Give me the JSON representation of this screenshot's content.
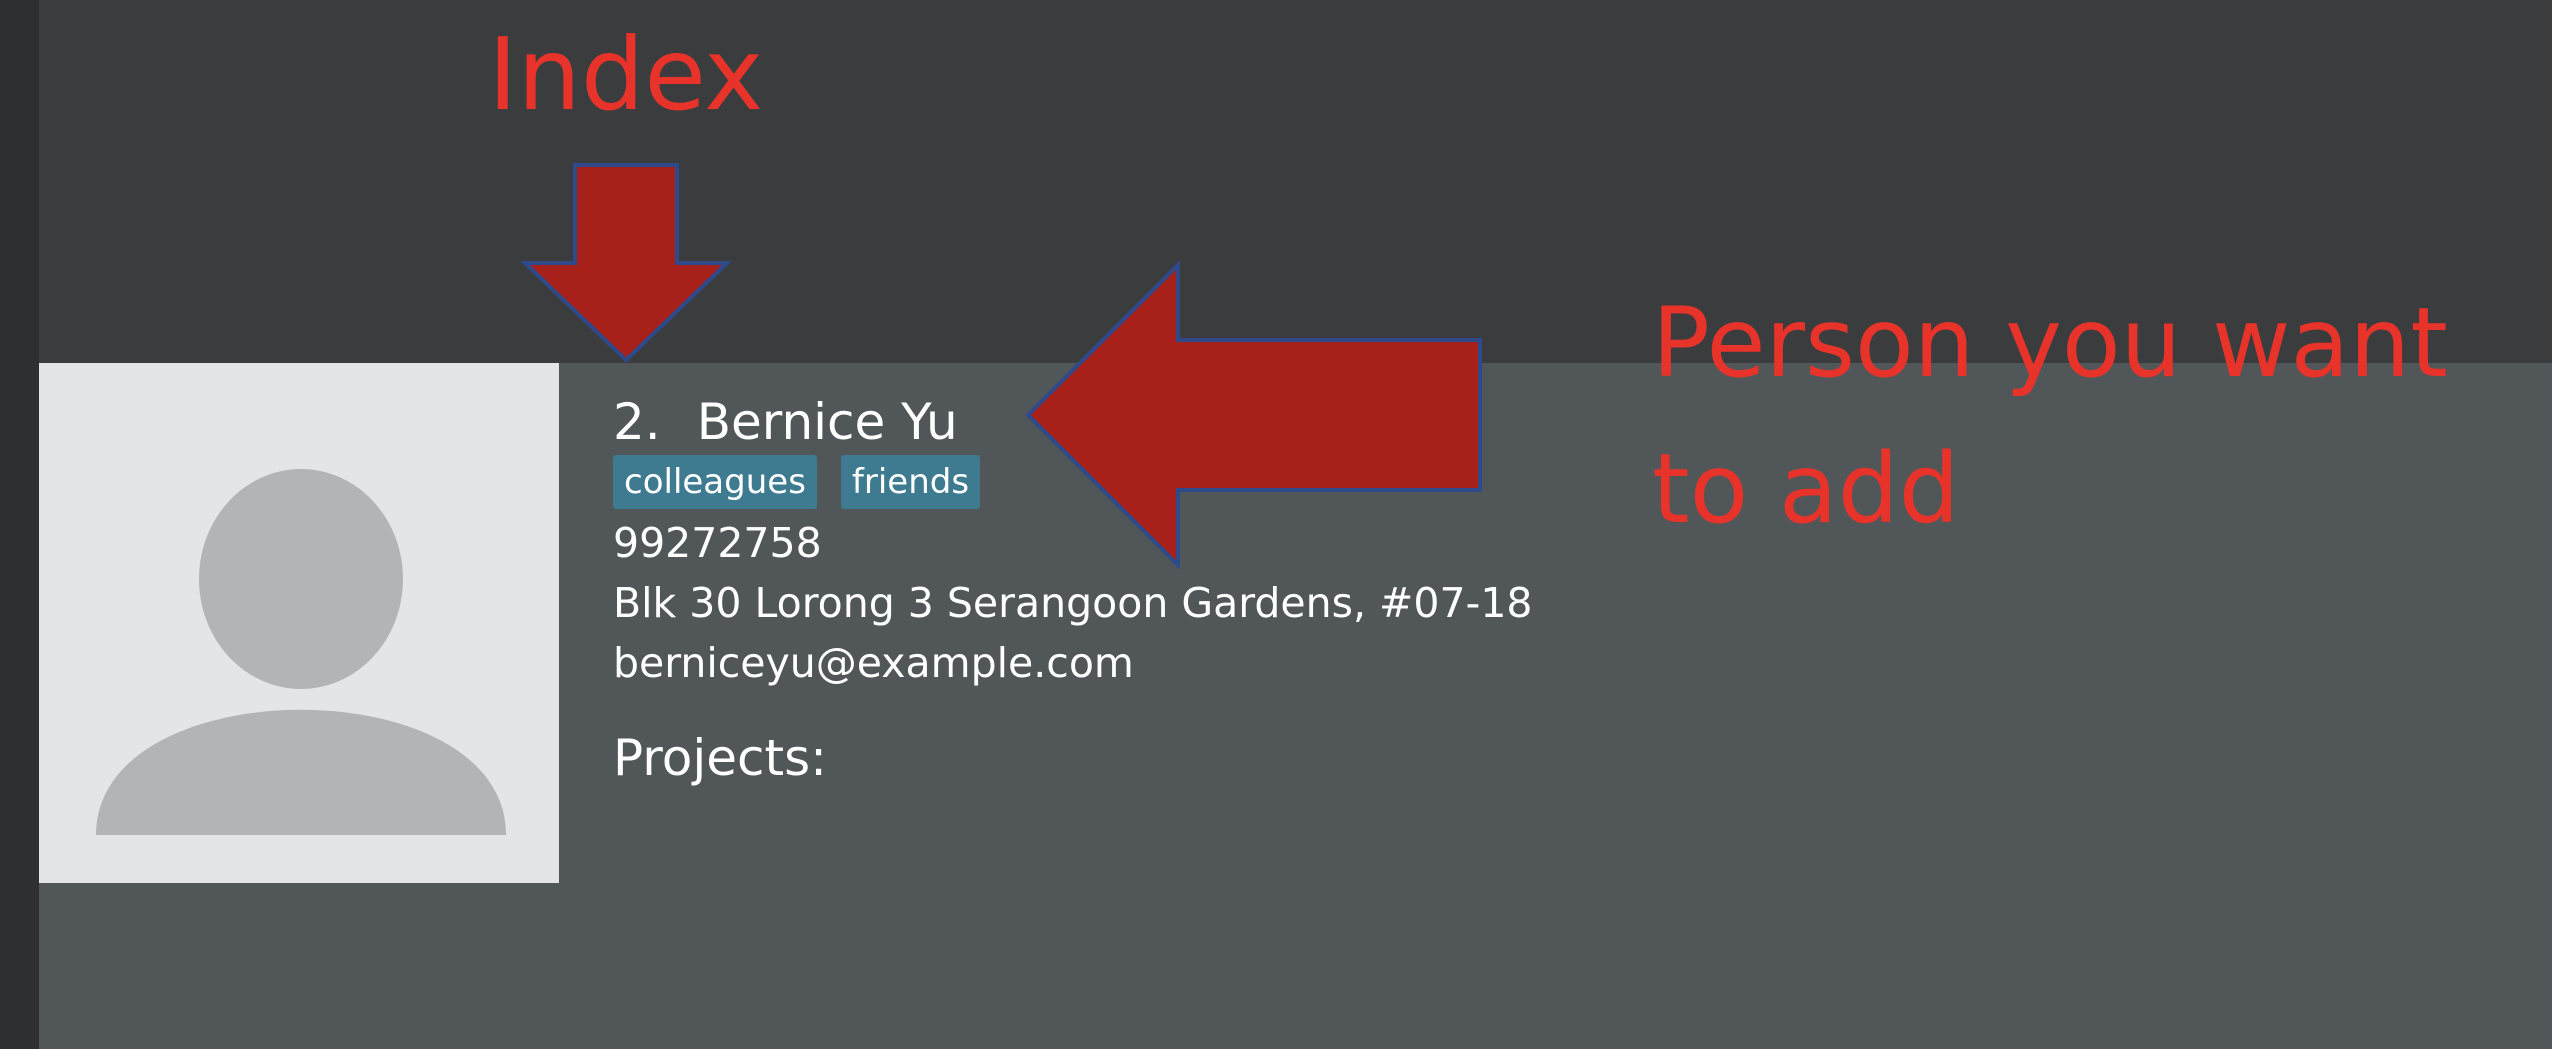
{
  "annotations": {
    "index_label": "Index",
    "person_label": "Person you want to add"
  },
  "person": {
    "index": "2.",
    "name": "Bernice Yu",
    "tags": [
      "colleagues",
      "friends"
    ],
    "phone": "99272758",
    "address": "Blk 30 Lorong 3 Serangoon Gardens, #07-18",
    "email": "berniceyu@example.com",
    "projects_label": "Projects:"
  },
  "colors": {
    "annotation_red": "#e8332a",
    "arrow_fill": "#a8201a",
    "arrow_outline": "#2f4a8a",
    "tag_bg": "#3e7b91",
    "card_bg": "#515658",
    "background": "#3b3c3e"
  },
  "icons": {
    "avatar": "person-silhouette-icon",
    "annotation_arrows": [
      "arrow-down-icon",
      "arrow-left-icon"
    ]
  }
}
